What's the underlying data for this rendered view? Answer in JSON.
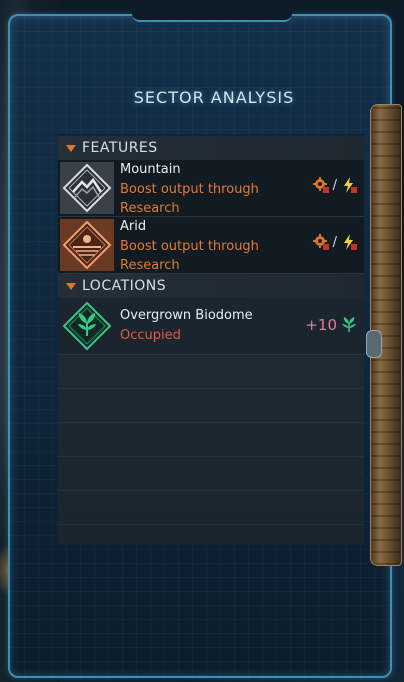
{
  "panel": {
    "title": "SECTOR ANALYSIS"
  },
  "sections": {
    "features": {
      "label": "FEATURES"
    },
    "locations": {
      "label": "LOCATIONS"
    }
  },
  "features": [
    {
      "name": "Mountain",
      "desc_line1": "Boost output through",
      "desc_line2": "Research",
      "icon": "mountain-icon",
      "bonus_icons": [
        "research-gear-icon",
        "energy-bolt-icon"
      ],
      "bonus_separator": "/"
    },
    {
      "name": "Arid",
      "desc_line1": "Boost output through",
      "desc_line2": "Research",
      "icon": "arid-sun-icon",
      "bonus_icons": [
        "research-gear-icon",
        "energy-bolt-icon"
      ],
      "bonus_separator": "/"
    }
  ],
  "locations": [
    {
      "name": "Overgrown Biodome",
      "status": "Occupied",
      "icon": "biodome-leaf-icon",
      "bonus_value": "+10",
      "bonus_icon": "food-leaf-icon"
    }
  ],
  "colors": {
    "accent_orange": "#e07a34",
    "status_red": "#e05a4a",
    "frame_blue": "#3f8fb0",
    "bonus_pink": "#e07aa0",
    "leaf_green": "#3cc48a"
  }
}
